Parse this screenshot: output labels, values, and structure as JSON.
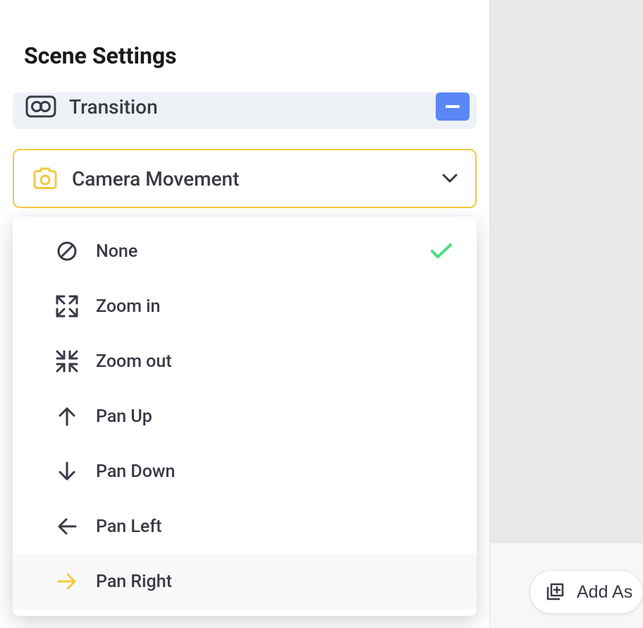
{
  "title": "Scene Settings",
  "transition": {
    "label": "Transition"
  },
  "camera": {
    "label": "Camera Movement",
    "options": [
      {
        "icon": "none",
        "label": "None",
        "selected": true
      },
      {
        "icon": "zoom-in",
        "label": "Zoom in",
        "selected": false
      },
      {
        "icon": "zoom-out",
        "label": "Zoom out",
        "selected": false
      },
      {
        "icon": "pan-up",
        "label": "Pan Up",
        "selected": false
      },
      {
        "icon": "pan-down",
        "label": "Pan Down",
        "selected": false
      },
      {
        "icon": "pan-left",
        "label": "Pan Left",
        "selected": false
      },
      {
        "icon": "pan-right",
        "label": "Pan Right",
        "selected": false,
        "hovered": true
      }
    ]
  },
  "rightPanel": {
    "addAssetLabel": "Add As"
  },
  "colors": {
    "accent": "#f5c842",
    "primary": "#5b87f5",
    "check": "#4ade80",
    "text": "#3a3a46"
  }
}
